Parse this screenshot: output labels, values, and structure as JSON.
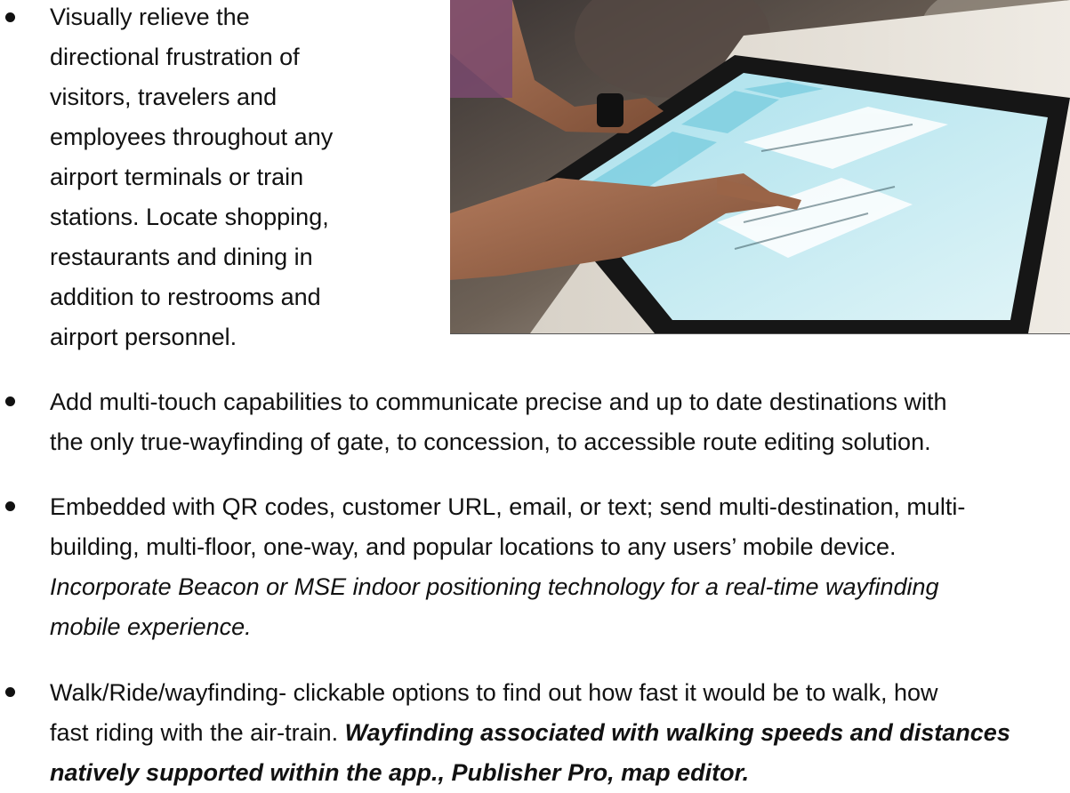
{
  "bullets": [
    {
      "lines": [
        "Visually relieve the",
        "directional frustration of",
        "visitors, travelers and",
        "employees throughout any",
        "airport terminals or train",
        "stations. Locate shopping,",
        "restaurants and dining in",
        "addition to restrooms and",
        "airport personnel."
      ]
    },
    {
      "lines": [
        "Add multi-touch capabilities to communicate precise and up to date destinations with",
        "the only true-wayfinding of gate, to concession, to accessible route editing solution."
      ]
    },
    {
      "lines": [
        "Embedded with QR codes, customer URL, email, or text; send multi-destination, multi-",
        "building, multi-floor, one-way, and popular locations to any users’ mobile device."
      ],
      "italic_lines": [
        "Incorporate Beacon or MSE indoor positioning technology for a real-time wayfinding",
        "mobile experience."
      ]
    },
    {
      "line1_plain": "Walk/Ride/wayfinding- clickable options to find out how fast it would be to walk, how",
      "line2_plain": "fast riding with the air-train. ",
      "line2_bold_italic": "Wayfinding associated with walking speeds and distances",
      "line3_bold_italic": "natively supported within the app., Publisher Pro, map editor."
    }
  ]
}
